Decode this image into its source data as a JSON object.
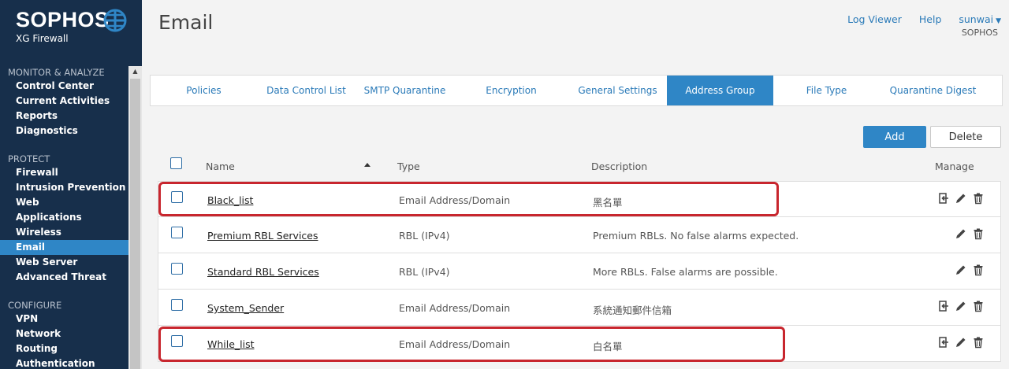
{
  "brand": {
    "name": "SOPHOS",
    "product": "XG Firewall"
  },
  "sidebar": {
    "sections": [
      {
        "title": "MONITOR & ANALYZE",
        "items": [
          "Control Center",
          "Current Activities",
          "Reports",
          "Diagnostics"
        ]
      },
      {
        "title": "PROTECT",
        "items": [
          "Firewall",
          "Intrusion Prevention",
          "Web",
          "Applications",
          "Wireless",
          "Email",
          "Web Server",
          "Advanced Threat"
        ]
      },
      {
        "title": "CONFIGURE",
        "items": [
          "VPN",
          "Network",
          "Routing",
          "Authentication"
        ]
      }
    ],
    "active_item": "Email"
  },
  "header": {
    "title": "Email",
    "log_viewer": "Log Viewer",
    "help": "Help",
    "user": "sunwai",
    "company": "SOPHOS"
  },
  "tabs": [
    {
      "label": "Policies",
      "active": false
    },
    {
      "label": "Data Control List",
      "active": false
    },
    {
      "label": "SMTP Quarantine",
      "active": false
    },
    {
      "label": "Encryption",
      "active": false
    },
    {
      "label": "General Settings",
      "active": false
    },
    {
      "label": "Address Group",
      "active": true
    },
    {
      "label": "File Type",
      "active": false
    },
    {
      "label": "Quarantine Digest",
      "active": false
    }
  ],
  "actions": {
    "add": "Add",
    "delete": "Delete"
  },
  "table": {
    "headers": {
      "name": "Name",
      "type": "Type",
      "description": "Description",
      "manage": "Manage"
    },
    "rows": [
      {
        "name": "Black_list",
        "type": "Email Address/Domain",
        "description": "黑名單",
        "icons": [
          "import-icon",
          "edit-icon",
          "delete-icon"
        ],
        "highlighted": true
      },
      {
        "name": "Premium RBL Services",
        "type": "RBL (IPv4)",
        "description": "Premium RBLs. No false alarms expected.",
        "icons": [
          "edit-icon",
          "delete-icon"
        ],
        "highlighted": false
      },
      {
        "name": "Standard RBL Services",
        "type": "RBL (IPv4)",
        "description": "More RBLs. False alarms are possible.",
        "icons": [
          "edit-icon",
          "delete-icon"
        ],
        "highlighted": false
      },
      {
        "name": "System_Sender",
        "type": "Email Address/Domain",
        "description": "系統通知郵件信箱",
        "icons": [
          "import-icon",
          "edit-icon",
          "delete-icon"
        ],
        "highlighted": false
      },
      {
        "name": "While_list",
        "type": "Email Address/Domain",
        "description": "白名單",
        "icons": [
          "import-icon",
          "edit-icon",
          "delete-icon"
        ],
        "highlighted": true
      }
    ]
  },
  "colors": {
    "sidebar": "#172f4b",
    "accent": "#2f86c6",
    "highlight": "#c8262e",
    "link": "#2a7ab8"
  }
}
